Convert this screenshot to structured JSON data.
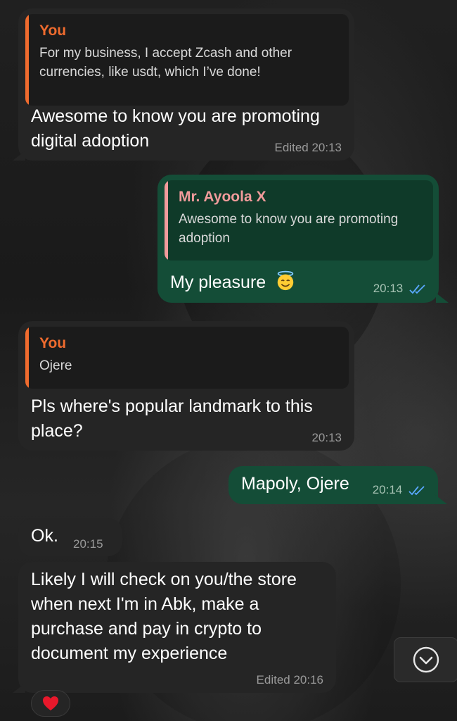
{
  "colors": {
    "incoming_bubble": "#252525",
    "outgoing_bubble": "#144d37",
    "quote_you_accent": "#ef6b2e",
    "quote_contact_accent": "#f19b9b",
    "read_ticks": "#5aa8ff",
    "meta_text": "#9a9a9a"
  },
  "messages": [
    {
      "direction": "incoming",
      "quote": {
        "author": "You",
        "text": "For my business, I accept Zcash and other currencies, like usdt, which I’ve done!"
      },
      "text": "Awesome to know you are promoting digital adoption",
      "meta": "Edited 20:13"
    },
    {
      "direction": "outgoing",
      "quote": {
        "author": "Mr. Ayoola X",
        "text": "Awesome to know you are promoting adoption"
      },
      "text": "My pleasure",
      "emoji": "smiling-face-with-halo",
      "time": "20:13",
      "status": "read"
    },
    {
      "direction": "incoming",
      "quote": {
        "author": "You",
        "text": "Ojere"
      },
      "text": "Pls where's popular landmark to this place?",
      "time": "20:13"
    },
    {
      "direction": "outgoing",
      "text": "Mapoly, Ojere",
      "time": "20:14",
      "status": "read"
    },
    {
      "direction": "incoming",
      "text": "Ok.",
      "time": "20:15"
    },
    {
      "direction": "incoming",
      "text": "Likely I will check on you/the store when next I'm in Abk, make a purchase and pay in crypto to document my experience",
      "meta": "Edited 20:16",
      "reaction": "heart"
    }
  ],
  "scroll_button": {
    "icon": "chevron-down-circle-icon"
  }
}
